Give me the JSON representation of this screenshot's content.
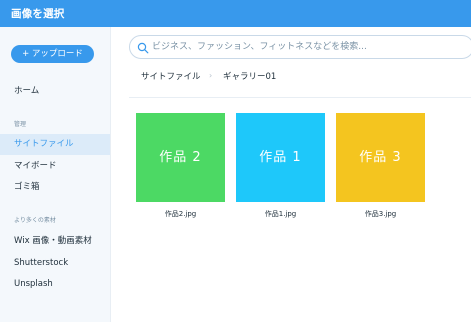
{
  "window": {
    "title": "画像を選択"
  },
  "sidebar": {
    "upload_label": "+ アップロード",
    "items": [
      {
        "label": "ホーム"
      },
      {
        "label": "サイトファイル"
      },
      {
        "label": "マイボード"
      },
      {
        "label": "ゴミ箱"
      },
      {
        "label": "Wix 画像・動画素材"
      },
      {
        "label": "Shutterstock"
      },
      {
        "label": "Unsplash"
      }
    ],
    "sections": [
      {
        "label": "管理"
      },
      {
        "label": "より多くの素材"
      }
    ],
    "active_item": "サイトファイル"
  },
  "search": {
    "placeholder": "ビジネス、ファッション、フィットネスなどを検索...",
    "value": ""
  },
  "breadcrumb": {
    "items": [
      "サイトファイル",
      "ギャラリー01"
    ],
    "separator": "›"
  },
  "files": [
    {
      "tile_text": "作品 2",
      "filename": "作品2.jpg",
      "color": "#4cd964"
    },
    {
      "tile_text": "作品 1",
      "filename": "作品1.jpg",
      "color": "#1ec8fa"
    },
    {
      "tile_text": "作品 3",
      "filename": "作品3.jpg",
      "color": "#f4c51f"
    }
  ],
  "colors": {
    "accent": "#3899ec",
    "sidebar_bg": "#f4f8fc",
    "active_bg": "#dcebf9"
  }
}
